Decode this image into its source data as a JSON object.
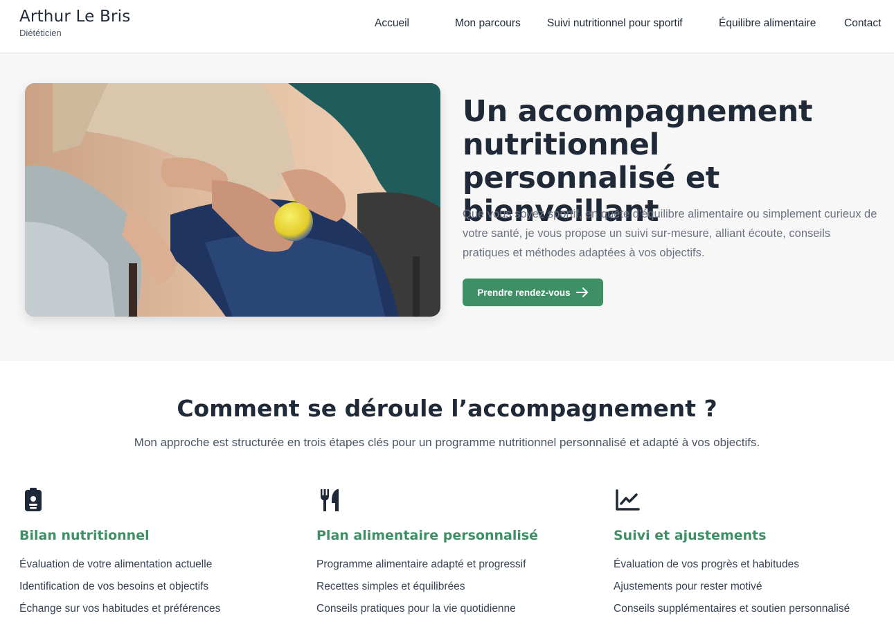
{
  "brand": {
    "name": "Arthur Le Bris",
    "subtitle": "Diététicien"
  },
  "nav": [
    "Accueil",
    "Mon parcours",
    "Suivi nutritionnel pour sportif",
    "Équilibre alimentaire",
    "Contact"
  ],
  "hero": {
    "title": "Un accompagnement nutritionnel personnalisé et bienveillant",
    "text": "Que vous soyez sportif, en quête d'équilibre alimentaire ou simplement curieux de votre santé, je vous propose un suivi sur-mesure, alliant écoute, conseils pratiques et méthodes adaptées à vos objectifs.",
    "cta_label": "Prendre rendez-vous",
    "image_icon": "photo-elderly-hands-ball"
  },
  "steps_section": {
    "title": "Comment se déroule l’accompagnement ?",
    "subtitle": "Mon approche est structurée en trois étapes clés pour un programme nutritionnel personnalisé et adapté à vos objectifs.",
    "steps": [
      {
        "icon": "clipboard-icon",
        "title": "Bilan nutritionnel",
        "items": [
          "Évaluation de votre alimentation actuelle",
          "Identification de vos besoins et objectifs",
          "Échange sur vos habitudes et préférences"
        ]
      },
      {
        "icon": "utensils-icon",
        "title": "Plan alimentaire personnalisé",
        "items": [
          "Programme alimentaire adapté et progressif",
          "Recettes simples et équilibrées",
          "Conseils pratiques pour la vie quotidienne"
        ]
      },
      {
        "icon": "chart-line-icon",
        "title": "Suivi et ajustements",
        "items": [
          "Évaluation de vos progrès et habitudes",
          "Ajustements pour rester motivé",
          "Conseils supplémentaires et soutien personnalisé"
        ]
      }
    ]
  },
  "colors": {
    "accent": "#3f8f66",
    "text": "#1f2937",
    "muted": "#6b7280",
    "hero_bg": "#f7f7f7"
  }
}
